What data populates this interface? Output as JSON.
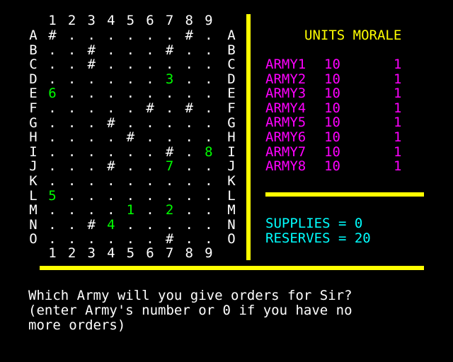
{
  "colors": {
    "background": "#000000",
    "grid_text": "#ffffff",
    "army_on_map": "#00ff00",
    "header": "#ffff00",
    "army_list": "#ff00ff",
    "status": "#00ffff",
    "divider": "#ffff00"
  },
  "board": {
    "column_labels": [
      "1",
      "2",
      "3",
      "4",
      "5",
      "6",
      "7",
      "8",
      "9"
    ],
    "rows": [
      {
        "label": "A",
        "cells": [
          "#",
          ".",
          ".",
          ".",
          ".",
          ".",
          ".",
          "#",
          "."
        ]
      },
      {
        "label": "B",
        "cells": [
          ".",
          ".",
          "#",
          ".",
          ".",
          ".",
          "#",
          ".",
          "."
        ]
      },
      {
        "label": "C",
        "cells": [
          ".",
          ".",
          "#",
          ".",
          ".",
          ".",
          ".",
          ".",
          "."
        ]
      },
      {
        "label": "D",
        "cells": [
          ".",
          ".",
          ".",
          ".",
          ".",
          ".",
          "3",
          ".",
          "."
        ]
      },
      {
        "label": "E",
        "cells": [
          "6",
          ".",
          ".",
          ".",
          ".",
          ".",
          ".",
          ".",
          "."
        ]
      },
      {
        "label": "F",
        "cells": [
          ".",
          ".",
          ".",
          ".",
          ".",
          "#",
          ".",
          "#",
          "."
        ]
      },
      {
        "label": "G",
        "cells": [
          ".",
          ".",
          ".",
          "#",
          ".",
          ".",
          ".",
          ".",
          "."
        ]
      },
      {
        "label": "H",
        "cells": [
          ".",
          ".",
          ".",
          ".",
          "#",
          ".",
          ".",
          ".",
          "."
        ]
      },
      {
        "label": "I",
        "cells": [
          ".",
          ".",
          ".",
          ".",
          ".",
          ".",
          "#",
          ".",
          "8"
        ]
      },
      {
        "label": "J",
        "cells": [
          ".",
          ".",
          ".",
          "#",
          ".",
          ".",
          "7",
          ".",
          "."
        ]
      },
      {
        "label": "K",
        "cells": [
          ".",
          ".",
          ".",
          ".",
          ".",
          ".",
          ".",
          ".",
          "."
        ]
      },
      {
        "label": "L",
        "cells": [
          "5",
          ".",
          ".",
          ".",
          ".",
          ".",
          ".",
          ".",
          "."
        ]
      },
      {
        "label": "M",
        "cells": [
          ".",
          ".",
          ".",
          ".",
          "1",
          ".",
          "2",
          ".",
          "."
        ]
      },
      {
        "label": "N",
        "cells": [
          ".",
          ".",
          "#",
          "4",
          ".",
          ".",
          ".",
          ".",
          "."
        ]
      },
      {
        "label": "O",
        "cells": [
          ".",
          ".",
          ".",
          ".",
          ".",
          ".",
          "#",
          ".",
          "."
        ]
      }
    ]
  },
  "panel": {
    "header": "UNITS MORALE",
    "armies": [
      {
        "name": "ARMY1",
        "units": "10",
        "morale": "1"
      },
      {
        "name": "ARMY2",
        "units": "10",
        "morale": "1"
      },
      {
        "name": "ARMY3",
        "units": "10",
        "morale": "1"
      },
      {
        "name": "ARMY4",
        "units": "10",
        "morale": "1"
      },
      {
        "name": "ARMY5",
        "units": "10",
        "morale": "1"
      },
      {
        "name": "ARMY6",
        "units": "10",
        "morale": "1"
      },
      {
        "name": "ARMY7",
        "units": "10",
        "morale": "1"
      },
      {
        "name": "ARMY8",
        "units": "10",
        "morale": "1"
      }
    ],
    "supplies": "SUPPLIES = 0",
    "reserves": "RESERVES = 20"
  },
  "prompt": {
    "line1": "Which Army will you give orders for Sir?",
    "line2": "(enter Army's number or 0 if you have no",
    "line3": "more orders)"
  }
}
